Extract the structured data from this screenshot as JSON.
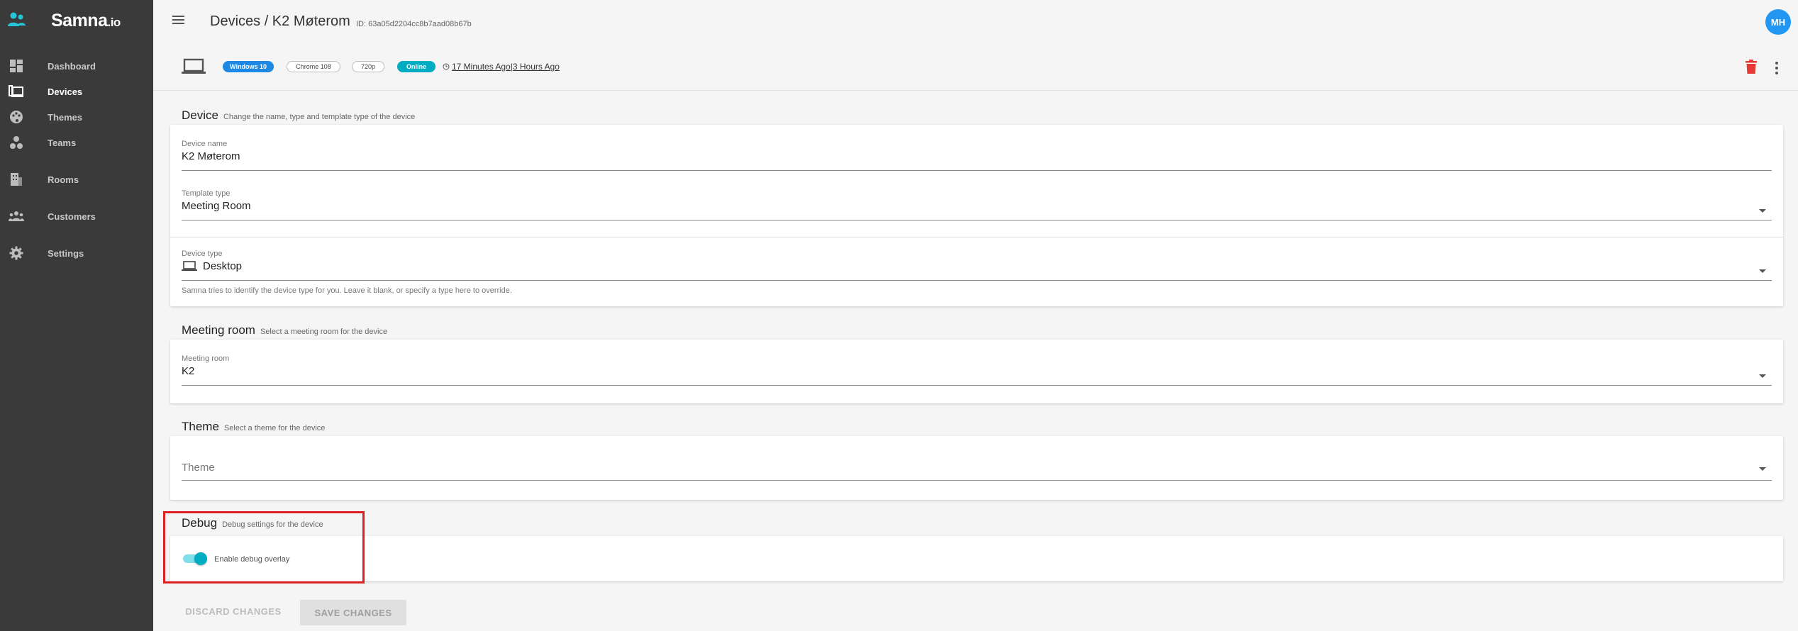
{
  "brand": {
    "name": "Samna",
    "suffix": ".io"
  },
  "sidebar": {
    "items": [
      {
        "label": "Dashboard",
        "icon": "dashboard-icon"
      },
      {
        "label": "Devices",
        "icon": "devices-icon",
        "active": true
      },
      {
        "label": "Themes",
        "icon": "palette-icon"
      },
      {
        "label": "Teams",
        "icon": "teams-icon"
      },
      {
        "label": "Rooms",
        "icon": "building-icon"
      },
      {
        "label": "Customers",
        "icon": "people-icon"
      },
      {
        "label": "Settings",
        "icon": "gear-icon"
      }
    ]
  },
  "header": {
    "title": "Devices / K2 Møterom",
    "id_text": "ID: 63a05d2204cc8b7aad08b67b",
    "avatar_initials": "MH"
  },
  "device_info": {
    "os": "Windows 10",
    "browser": "Chrome 108",
    "resolution": "720p",
    "status": "Online",
    "last_seen": "17 Minutes Ago",
    "separator": "|",
    "uptime": "3 Hours Ago"
  },
  "device_section": {
    "title": "Device",
    "subtitle": "Change the name, type and template type of the device",
    "name_label": "Device name",
    "name_value": "K2 Møterom",
    "template_label": "Template type",
    "template_value": "Meeting Room",
    "type_label": "Device type",
    "type_value": "Desktop",
    "type_helper": "Samna tries to identify the device type for you. Leave it blank, or specify a type here to override."
  },
  "meeting_section": {
    "title": "Meeting room",
    "subtitle": "Select a meeting room for the device",
    "label": "Meeting room",
    "value": "K2"
  },
  "theme_section": {
    "title": "Theme",
    "subtitle": "Select a theme for the device",
    "placeholder": "Theme"
  },
  "debug_section": {
    "title": "Debug",
    "subtitle": "Debug settings for the device",
    "toggle_label": "Enable debug overlay",
    "toggle_on": true
  },
  "actions": {
    "discard": "DISCARD CHANGES",
    "save": "SAVE CHANGES"
  },
  "colors": {
    "sidebar_bg": "#3a3a3a",
    "accent_teal": "#00acc1",
    "accent_blue": "#1e88e5",
    "delete_red": "#e53935",
    "highlight_red": "#e02020"
  }
}
